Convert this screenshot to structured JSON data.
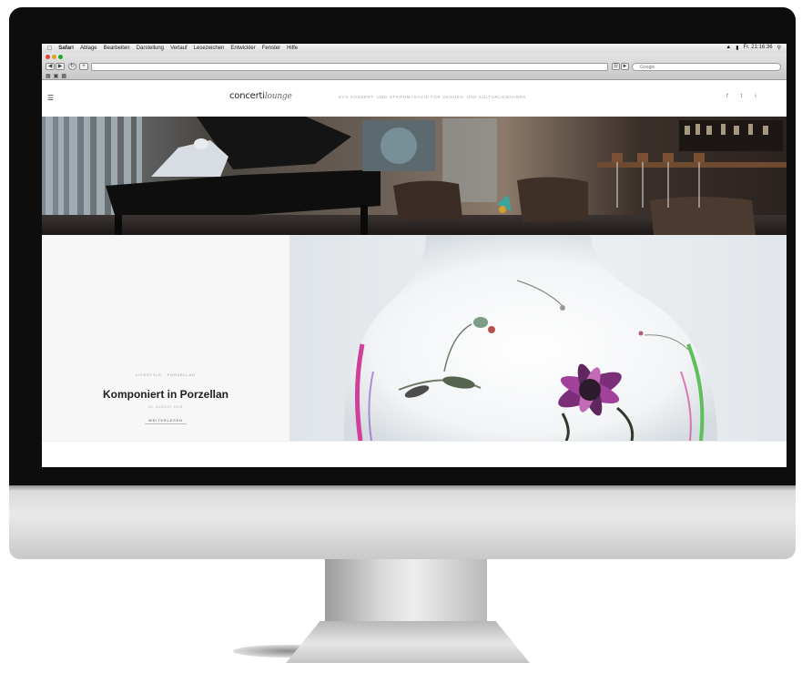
{
  "menubar": {
    "apple": "",
    "items": [
      "Safari",
      "Ablage",
      "Bearbeiten",
      "Darstellung",
      "Verlauf",
      "Lesezeichen",
      "Entwickler",
      "Fenster",
      "Hilfe"
    ],
    "clock": "Fr. 21:16:36"
  },
  "browser": {
    "url": "",
    "search_placeholder": "Google"
  },
  "site": {
    "logo_main": "concerti",
    "logo_script": "lounge",
    "tagline": "DAS KONZERT- UND OPERNMAGAZIN FÜR GENUSS- UND KULTURLIEBHABER",
    "social": [
      "f",
      "t",
      "i"
    ]
  },
  "feature": {
    "category": "LIFESTYLE · PORZELLAN",
    "title": "Komponiert in Porzellan",
    "date": "01. AUGUST 2015",
    "more_label": "WEITERLESEN"
  },
  "colors": {
    "bezel": "#0d0d0d",
    "aluminium": "#dcdcdc",
    "menubar": "#e8e8e8",
    "title_text": "#1e1e1e"
  }
}
